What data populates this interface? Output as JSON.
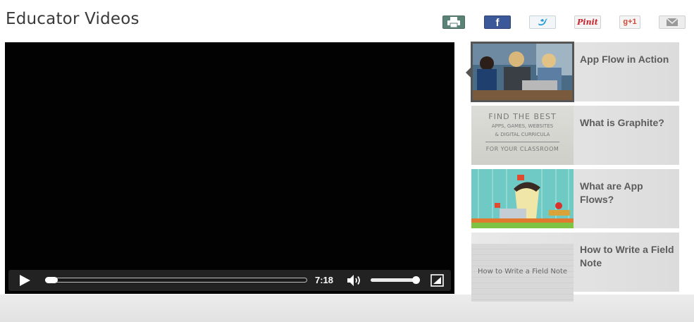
{
  "page": {
    "title": "Educator Videos"
  },
  "share_bar": {
    "items": [
      {
        "name": "print",
        "icon": "printer-icon"
      },
      {
        "name": "facebook",
        "icon": "facebook-icon",
        "glyph": "f"
      },
      {
        "name": "twitter",
        "icon": "twitter-bird-icon"
      },
      {
        "name": "pinterest",
        "label": "Pinit"
      },
      {
        "name": "google-plus",
        "label": "g+1"
      },
      {
        "name": "email",
        "icon": "envelope-icon"
      }
    ]
  },
  "player": {
    "state": "paused",
    "duration": "7:18",
    "progress": 0.0,
    "volume": 1.0,
    "icons": [
      "play-icon",
      "volume-icon",
      "fullscreen-icon"
    ]
  },
  "playlist": {
    "items": [
      {
        "title": "App Flow in Action",
        "active": true
      },
      {
        "title": "What is Graphite?",
        "thumb_lines": [
          "FIND THE BEST",
          "APPS, GAMES, WEBSITES",
          "& DIGITAL CURRICULA",
          "FOR YOUR CLASSROOM"
        ]
      },
      {
        "title": "What are App Flows?"
      },
      {
        "title": "How to Write a Field Note",
        "thumb_caption": "How to Write a Field Note"
      }
    ]
  },
  "colors": {
    "facebook": "#3b5998",
    "print": "#5b8277",
    "pinterest": "#cb2027",
    "google_plus": "#d34836",
    "active_border": "#555555"
  }
}
